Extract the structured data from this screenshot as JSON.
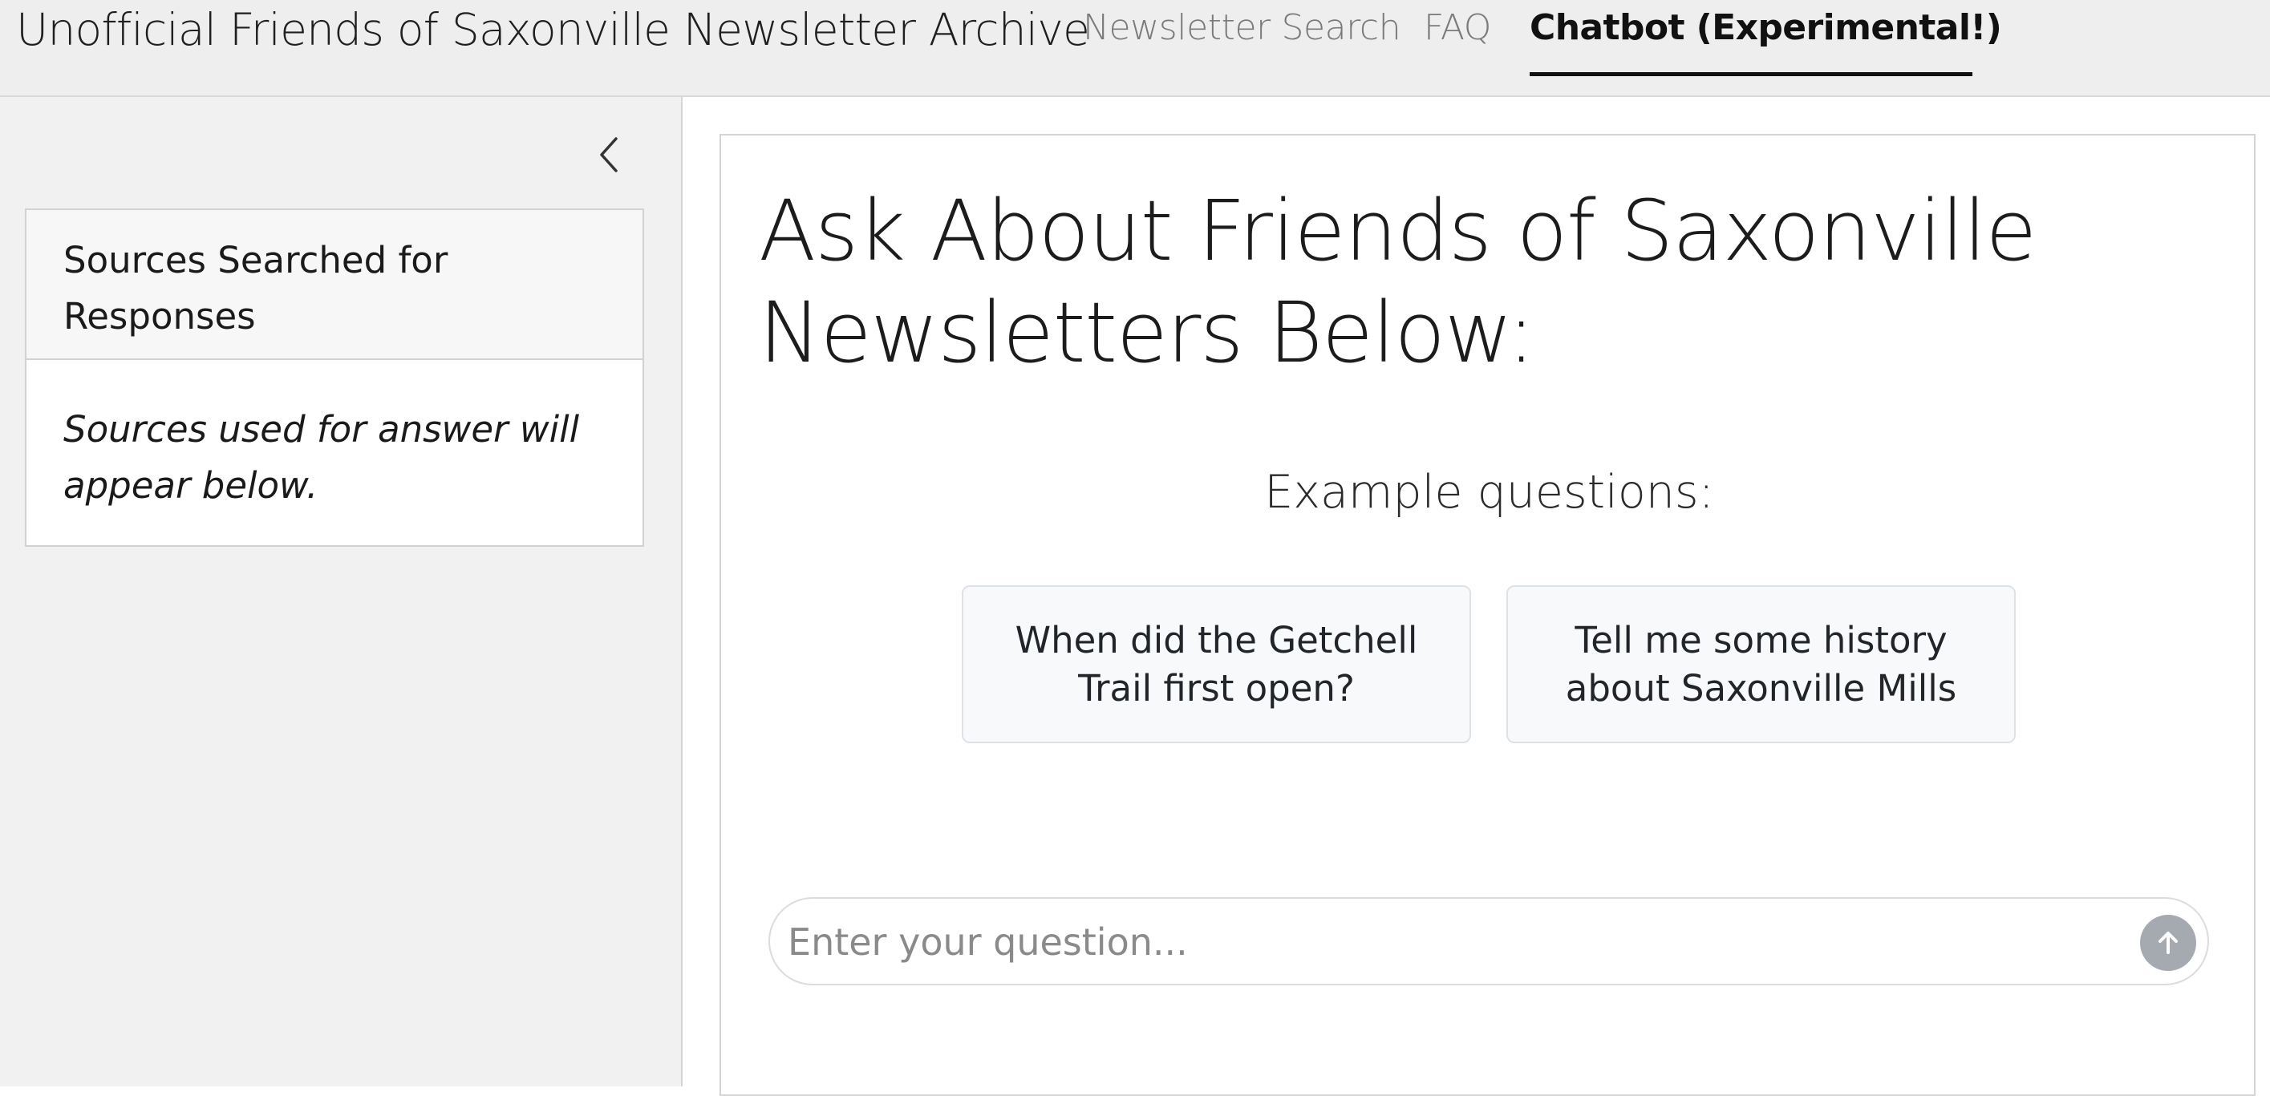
{
  "header": {
    "brand": "Unofficial Friends of Saxonville Newsletter Archive",
    "nav": {
      "search_label": "Newsletter Search",
      "faq_label": "FAQ",
      "chat_label": "Chatbot (Experimental!)",
      "active": "Chatbot (Experimental!)"
    }
  },
  "sidebar": {
    "collapse_icon": "chevron-left-icon",
    "sources": {
      "header": "Sources Searched for Responses",
      "body": "Sources used for answer will appear below."
    }
  },
  "main": {
    "title": "Ask About Friends of Saxonville Newsletters Below:",
    "example_heading": "Example questions:",
    "examples": [
      "When did the Getchell Trail first open?",
      "Tell me some history about Saxonville Mills"
    ],
    "question": {
      "placeholder": "Enter your question...",
      "value": ""
    },
    "send_icon": "arrow-up-icon"
  },
  "colors": {
    "nav_background": "#eeeeee",
    "sidebar_background": "#f1f1f1",
    "example_button_background": "#f8f9fa",
    "send_button": "#a5aab0"
  }
}
